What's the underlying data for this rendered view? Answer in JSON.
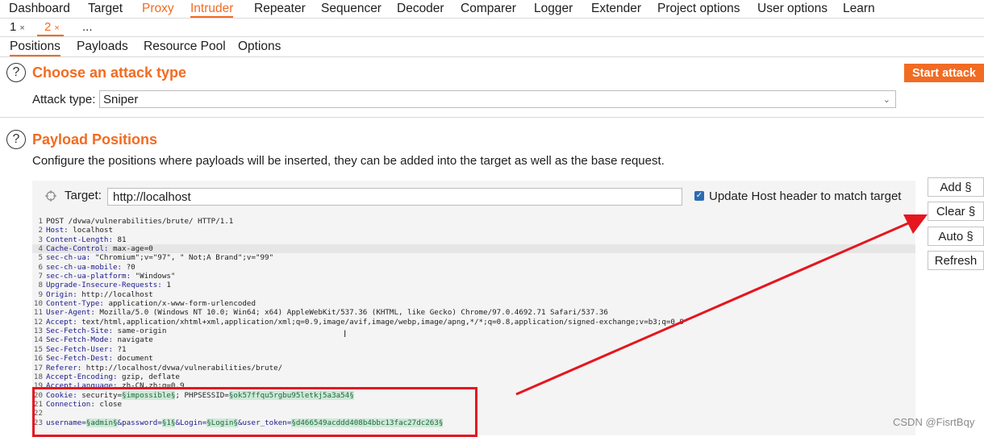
{
  "top_nav": [
    "Dashboard",
    "Target",
    "Proxy",
    "Intruder",
    "Repeater",
    "Sequencer",
    "Decoder",
    "Comparer",
    "Logger",
    "Extender",
    "Project options",
    "User options",
    "Learn"
  ],
  "sub_tabs": [
    {
      "label": "1",
      "close": "×"
    },
    {
      "label": "2",
      "close": "×"
    },
    {
      "label": "...",
      "close": ""
    }
  ],
  "inner_tabs": [
    "Positions",
    "Payloads",
    "Resource Pool",
    "Options"
  ],
  "attack_type": {
    "title": "Choose an attack type",
    "label": "Attack type:",
    "value": "Sniper",
    "start_button": "Start attack"
  },
  "payload_positions": {
    "title": "Payload Positions",
    "description": "Configure the positions where payloads will be inserted, they can be added into the target as well as the base request.",
    "target_label": "Target:",
    "target_value": "http://localhost",
    "update_host_label": "Update Host header to match target",
    "update_host_checked": true
  },
  "side_buttons": [
    "Add §",
    "Clear §",
    "Auto §",
    "Refresh"
  ],
  "request_lines": [
    {
      "n": "1",
      "parts": [
        {
          "t": "POST /dvwa/vulnerabilities/brute/ HTTP/1.1",
          "c": "hv"
        }
      ]
    },
    {
      "n": "2",
      "parts": [
        {
          "t": "Host: ",
          "c": "hk"
        },
        {
          "t": "localhost",
          "c": "hv"
        }
      ]
    },
    {
      "n": "3",
      "parts": [
        {
          "t": "Content-Length: ",
          "c": "hk"
        },
        {
          "t": "81",
          "c": "hv"
        }
      ]
    },
    {
      "n": "4",
      "hl": true,
      "parts": [
        {
          "t": "Cache-Control: ",
          "c": "hk"
        },
        {
          "t": "max-age=0",
          "c": "hv"
        }
      ]
    },
    {
      "n": "5",
      "parts": [
        {
          "t": "sec-ch-ua: ",
          "c": "hk"
        },
        {
          "t": "\"Chromium\";v=\"97\", \" Not;A Brand\";v=\"99\"",
          "c": "hv"
        }
      ]
    },
    {
      "n": "6",
      "parts": [
        {
          "t": "sec-ch-ua-mobile: ",
          "c": "hk"
        },
        {
          "t": "?0",
          "c": "hv"
        }
      ]
    },
    {
      "n": "7",
      "parts": [
        {
          "t": "sec-ch-ua-platform: ",
          "c": "hk"
        },
        {
          "t": "\"Windows\"",
          "c": "hv"
        }
      ]
    },
    {
      "n": "8",
      "parts": [
        {
          "t": "Upgrade-Insecure-Requests: ",
          "c": "hk"
        },
        {
          "t": "1",
          "c": "hv"
        }
      ]
    },
    {
      "n": "9",
      "parts": [
        {
          "t": "Origin: ",
          "c": "hk"
        },
        {
          "t": "http://localhost",
          "c": "hv"
        }
      ]
    },
    {
      "n": "10",
      "parts": [
        {
          "t": "Content-Type: ",
          "c": "hk"
        },
        {
          "t": "application/x-www-form-urlencoded",
          "c": "hv"
        }
      ]
    },
    {
      "n": "11",
      "parts": [
        {
          "t": "User-Agent: ",
          "c": "hk"
        },
        {
          "t": "Mozilla/5.0 (Windows NT 10.0; Win64; x64) AppleWebKit/537.36 (KHTML, like Gecko) Chrome/97.0.4692.71 Safari/537.36",
          "c": "hv"
        }
      ]
    },
    {
      "n": "12",
      "parts": [
        {
          "t": "Accept: ",
          "c": "hk"
        },
        {
          "t": "text/html,application/xhtml+xml,application/xml;q=0.9,image/avif,image/webp,image/apng,*/*;q=0.8,application/signed-exchange;v=b3;q=0.9",
          "c": "hv"
        }
      ]
    },
    {
      "n": "13",
      "parts": [
        {
          "t": "Sec-Fetch-Site: ",
          "c": "hk"
        },
        {
          "t": "same-origin",
          "c": "hv"
        }
      ]
    },
    {
      "n": "14",
      "parts": [
        {
          "t": "Sec-Fetch-Mode: ",
          "c": "hk"
        },
        {
          "t": "navigate",
          "c": "hv"
        }
      ]
    },
    {
      "n": "15",
      "parts": [
        {
          "t": "Sec-Fetch-User: ",
          "c": "hk"
        },
        {
          "t": "?1",
          "c": "hv"
        }
      ]
    },
    {
      "n": "16",
      "parts": [
        {
          "t": "Sec-Fetch-Dest: ",
          "c": "hk"
        },
        {
          "t": "document",
          "c": "hv"
        }
      ]
    },
    {
      "n": "17",
      "parts": [
        {
          "t": "Referer: ",
          "c": "hk"
        },
        {
          "t": "http://localhost/dvwa/vulnerabilities/brute/",
          "c": "hv"
        }
      ]
    },
    {
      "n": "18",
      "parts": [
        {
          "t": "Accept-Encoding: ",
          "c": "hk"
        },
        {
          "t": "gzip, deflate",
          "c": "hv"
        }
      ]
    },
    {
      "n": "19",
      "parts": [
        {
          "t": "Accept-Language: ",
          "c": "hk"
        },
        {
          "t": "zh-CN,zh;q=0.9",
          "c": "hv"
        }
      ]
    },
    {
      "n": "20",
      "parts": [
        {
          "t": "Cookie: ",
          "c": "hk"
        },
        {
          "t": "security=",
          "c": "hv"
        },
        {
          "t": "§impossible§",
          "c": "mk"
        },
        {
          "t": "; PHPSESSID=",
          "c": "hv"
        },
        {
          "t": "§ok57ffqu5rgbu95letkj5a3a54§",
          "c": "mk"
        }
      ]
    },
    {
      "n": "21",
      "parts": [
        {
          "t": "Connection: ",
          "c": "hk"
        },
        {
          "t": "close",
          "c": "hv"
        }
      ]
    },
    {
      "n": "22",
      "parts": []
    },
    {
      "n": "23",
      "parts": [
        {
          "t": "username=",
          "c": "hk"
        },
        {
          "t": "§admin§",
          "c": "mk"
        },
        {
          "t": "&password=",
          "c": "hk"
        },
        {
          "t": "§1§",
          "c": "mk"
        },
        {
          "t": "&Login=",
          "c": "hk"
        },
        {
          "t": "§Login§",
          "c": "mk"
        },
        {
          "t": "&user_token=",
          "c": "hk"
        },
        {
          "t": "§d466549acddd408b4bbc13fac27dc263§",
          "c": "mk"
        }
      ]
    }
  ],
  "watermark": "CSDN @FisrtBqy",
  "colors": {
    "accent": "#f26b22",
    "annotation": "#e5161f",
    "marker_bg": "#cfe8d8"
  }
}
